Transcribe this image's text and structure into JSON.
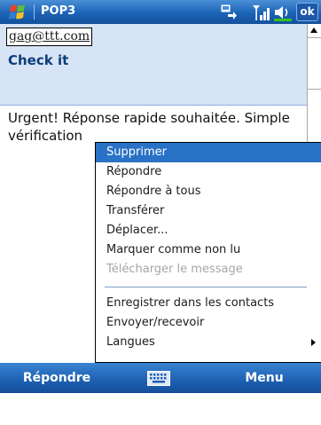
{
  "title_bar": {
    "title": "POP3",
    "ok_label": "ok",
    "icons": [
      "windows-start-icon",
      "sync-icon",
      "signal-icon",
      "volume-icon"
    ]
  },
  "message": {
    "sender": "gag@ttt.com",
    "subject": "Check it",
    "body": "Urgent! Réponse rapide souhaitée. Simple vérification"
  },
  "context_menu": {
    "items": [
      {
        "label": "Supprimer",
        "state": "selected"
      },
      {
        "label": "Répondre",
        "state": "normal"
      },
      {
        "label": "Répondre à tous",
        "state": "normal"
      },
      {
        "label": "Transférer",
        "state": "normal"
      },
      {
        "label": "Déplacer...",
        "state": "normal"
      },
      {
        "label": "Marquer comme non lu",
        "state": "normal"
      },
      {
        "label": "Télécharger le message",
        "state": "disabled"
      },
      {
        "label": "Enregistrer dans les contacts",
        "state": "normal"
      },
      {
        "label": "Envoyer/recevoir",
        "state": "normal"
      },
      {
        "label": "Langues",
        "state": "normal",
        "has_submenu": true
      }
    ]
  },
  "softkeys": {
    "left_label": "Répondre",
    "right_label": "Menu",
    "center_icon": "keyboard-icon"
  },
  "colors": {
    "title_bar": "#1b63b6",
    "header_background": "#d6e4f5",
    "selected_item": "#2a72c6",
    "disabled_text": "#a6a6a6",
    "subject_text": "#0c3d78"
  }
}
